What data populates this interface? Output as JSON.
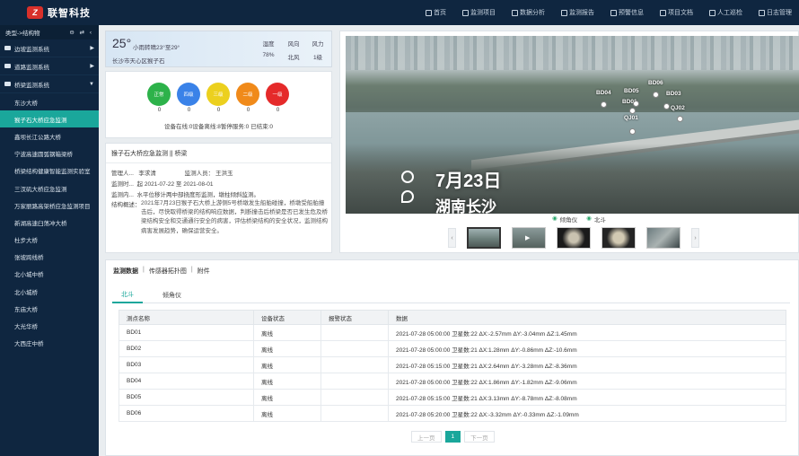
{
  "app": {
    "logo_mark": "Z",
    "name": "联智科技"
  },
  "topnav": [
    {
      "label": "首页"
    },
    {
      "label": "监测项目"
    },
    {
      "label": "数据分析"
    },
    {
      "label": "监测报告"
    },
    {
      "label": "预警信息"
    },
    {
      "label": "项目文档"
    },
    {
      "label": "人工巡检"
    },
    {
      "label": "日志管理"
    }
  ],
  "sidebar": {
    "header": "类型->结构物",
    "header_icons": "⊖ ⇄ ‹",
    "groups": [
      {
        "label": "边坡监测系统",
        "arrow": "▶"
      },
      {
        "label": "道路监测系统",
        "arrow": "▶"
      },
      {
        "label": "桥梁监测系统",
        "arrow": "▼"
      }
    ],
    "items": [
      {
        "label": "东沙大桥"
      },
      {
        "label": "猴子石大桥应急监测"
      },
      {
        "label": "鑫坝长江公路大桥"
      },
      {
        "label": "宁波高速圆弧钢箱梁桥"
      },
      {
        "label": "桥梁结构健康智能监测实验室"
      },
      {
        "label": "三汊矶大桥应急监测"
      },
      {
        "label": "万家丽路高架桥应急监测项目"
      },
      {
        "label": "新湖高速臼荡冲大桥"
      },
      {
        "label": "杜步大桥"
      },
      {
        "label": "张坡跨线桥"
      },
      {
        "label": "北小城中桥"
      },
      {
        "label": "北小城桥"
      },
      {
        "label": "东庙大桥"
      },
      {
        "label": "大光华桥"
      },
      {
        "label": "大西庄中桥"
      }
    ]
  },
  "weather": {
    "temp": "25°",
    "desc": "小雨转晴23°至29°",
    "location": "长沙市天心区猴子石",
    "cols": [
      {
        "label": "湿度",
        "value": "78%"
      },
      {
        "label": "风向",
        "value": "北风"
      },
      {
        "label": "风力",
        "value": "1级"
      }
    ]
  },
  "status": {
    "circles": [
      {
        "label": "正常",
        "value": "0",
        "color": "#2db24a"
      },
      {
        "label": "四级",
        "value": "0",
        "color": "#3a82e8"
      },
      {
        "label": "三级",
        "value": "0",
        "color": "#ecd01e"
      },
      {
        "label": "二级",
        "value": "0",
        "color": "#f08a1a"
      },
      {
        "label": "一级",
        "value": "0",
        "color": "#e52a2a"
      }
    ],
    "summary": "设备在线:0设备离线:8暂停服务:0  已结束:0"
  },
  "info": {
    "title": "猴子石大桥应急监测 || 桥梁",
    "manager_label": "管理人...",
    "manager": "李求清",
    "monitor_label": "监测人员：",
    "monitor": "王洪玉",
    "time_label": "监测时...",
    "time": "起 2021-07-22 至 2021-08-01",
    "content_label": "监测内...",
    "content": "水平位移计两中部挠度形监测，墩柱倾斜监测。",
    "desc_label": "结构概述：",
    "desc": "2021年7月23日猴子石大桥上游侧5号桥墩发生船舶碰撞，桥墩受船舶撞击后，尽快取得桥梁的结构响应数据，判断撞击后桥梁是否已发生危及桥梁结构安全和交通通行安全的病害，评估桥梁结构的安全状况，监测结构病害发展趋势，确保运营安全。"
  },
  "video": {
    "caption_date": "7月23日",
    "caption_place": "湖南长沙",
    "markers": [
      "BD04",
      "BD05",
      "BD06",
      "BD01",
      "BD03",
      "QJ01",
      "QJ02"
    ],
    "legend": [
      {
        "label": "倾角仪"
      },
      {
        "label": "北斗"
      }
    ],
    "thumb_prev": "‹",
    "thumb_next": "›"
  },
  "bottom": {
    "tabs": [
      {
        "label": "监测数据"
      },
      {
        "label": "传感器拓扑图"
      },
      {
        "label": "附件"
      }
    ],
    "tab_sep": "|",
    "subtabs": [
      {
        "label": "北斗"
      },
      {
        "label": "倾角仪"
      }
    ],
    "columns": [
      "测点名称",
      "设备状态",
      "报警状态",
      "数据"
    ],
    "rows": [
      {
        "name": "BD01",
        "state": "离线",
        "alarm": "",
        "data": "2021-07-28 05:00:00 卫星数:22 ΔX:-2.57mm ΔY:-3.04mm ΔZ:1.45mm"
      },
      {
        "name": "BD02",
        "state": "离线",
        "alarm": "",
        "data": "2021-07-28 05:00:00 卫星数:21 ΔX:1.28mm ΔY:-0.86mm ΔZ:-10.6mm"
      },
      {
        "name": "BD03",
        "state": "离线",
        "alarm": "",
        "data": "2021-07-28 05:15:00 卫星数:21 ΔX:2.64mm ΔY:-3.28mm ΔZ:-8.36mm"
      },
      {
        "name": "BD04",
        "state": "离线",
        "alarm": "",
        "data": "2021-07-28 05:00:00 卫星数:22 ΔX:1.86mm ΔY:-1.82mm ΔZ:-9.06mm"
      },
      {
        "name": "BD05",
        "state": "离线",
        "alarm": "",
        "data": "2021-07-28 05:15:00 卫星数:21 ΔX:3.13mm ΔY:-8.78mm ΔZ:-8.08mm"
      },
      {
        "name": "BD06",
        "state": "离线",
        "alarm": "",
        "data": "2021-07-28 05:20:00 卫星数:22 ΔX:-3.32mm ΔY:-0.33mm ΔZ:-1.09mm"
      }
    ],
    "pager": {
      "prev": "上一页",
      "current": "1",
      "next": "下一页"
    }
  },
  "colors": {
    "nav_bg": "#0f2640",
    "accent": "#1aa79b",
    "brand_red": "#d8302a"
  }
}
